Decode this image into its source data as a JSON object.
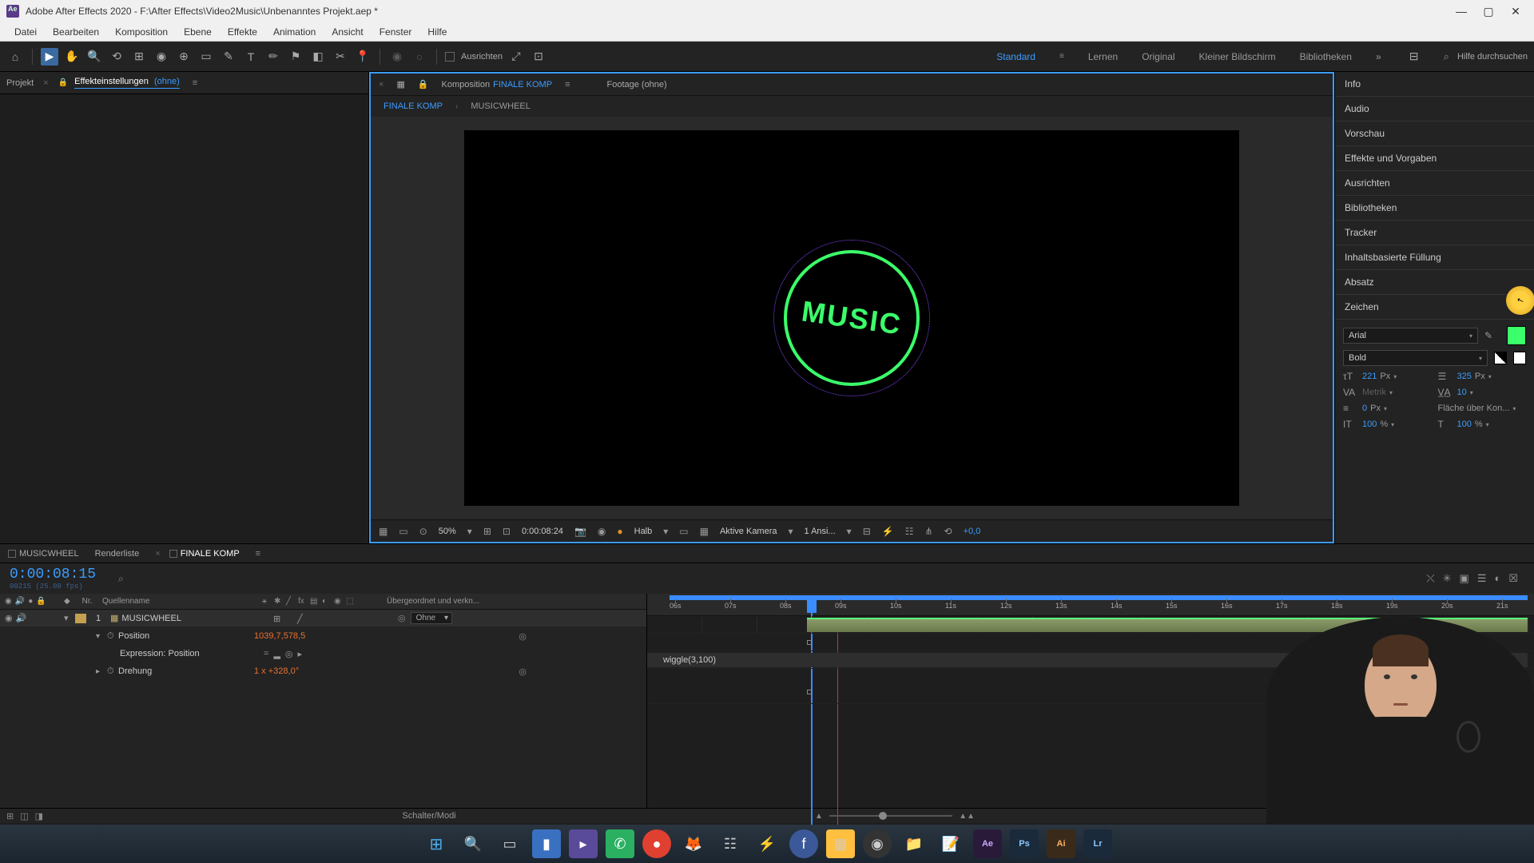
{
  "titlebar": {
    "text": "Adobe After Effects 2020 - F:\\After Effects\\Video2Music\\Unbenanntes Projekt.aep *"
  },
  "menubar": {
    "items": [
      "Datei",
      "Bearbeiten",
      "Komposition",
      "Ebene",
      "Effekte",
      "Animation",
      "Ansicht",
      "Fenster",
      "Hilfe"
    ]
  },
  "toolbar": {
    "align_label": "Ausrichten",
    "workspaces": {
      "items": [
        "Standard",
        "Lernen",
        "Original",
        "Kleiner Bildschirm",
        "Bibliotheken"
      ],
      "active": "Standard"
    },
    "search_placeholder": "Hilfe durchsuchen"
  },
  "left_panel": {
    "tabs": {
      "project": "Projekt",
      "effect_controls_prefix": "Effekteinstellungen",
      "effect_controls_suffix": "(ohne)"
    }
  },
  "center_panel": {
    "comp_tab_prefix": "Komposition",
    "comp_name": "FINALE KOMP",
    "footage_tab": "Footage  (ohne)",
    "breadcrumb": {
      "item1": "FINALE KOMP",
      "item2": "MUSICWHEEL"
    },
    "music_text": "MUSIC"
  },
  "viewport_controls": {
    "zoom": "50%",
    "timecode": "0:00:08:24",
    "resolution": "Halb",
    "camera": "Aktive Kamera",
    "views": "1 Ansi...",
    "exposure": "+0,0"
  },
  "right_panel": {
    "sections": [
      "Info",
      "Audio",
      "Vorschau",
      "Effekte und Vorgaben",
      "Ausrichten",
      "Bibliotheken",
      "Tracker",
      "Inhaltsbasierte Füllung",
      "Absatz"
    ],
    "character": {
      "title": "Zeichen",
      "font_family": "Arial",
      "font_style": "Bold",
      "font_size": "221",
      "font_size_unit": "Px",
      "leading": "325",
      "leading_unit": "Px",
      "kerning": "Metrik",
      "tracking": "10",
      "stroke_width": "0",
      "stroke_unit": "Px",
      "stroke_mode": "Fläche über Kon...",
      "vscale": "100",
      "hscale": "100",
      "percent": "%"
    }
  },
  "timeline": {
    "tabs": {
      "musicwheel": "MUSICWHEEL",
      "renderliste": "Renderliste",
      "finale_komp": "FINALE KOMP"
    },
    "timecode": "0:00:08:15",
    "framerate_hint": "00215 (25.00 fps)",
    "columns": {
      "nr": "Nr.",
      "name": "Quellenname",
      "parent": "Übergeordnet und verkn..."
    },
    "layer1": {
      "num": "1",
      "name": "MUSICWHEEL",
      "parent_none": "Ohne"
    },
    "props": {
      "position": "Position",
      "position_val": "1039,7,578,5",
      "expression_label": "Expression: Position",
      "rotation": "Drehung",
      "rotation_prefix": "1 x",
      "rotation_val": "+328,0°"
    },
    "expression_code": "wiggle(3,100)",
    "ruler_ticks": [
      "06s",
      "07s",
      "08s",
      "09s",
      "10s",
      "11s",
      "12s",
      "13s",
      "14s",
      "15s",
      "16s",
      "17s",
      "18s",
      "19s",
      "20s",
      "21s"
    ],
    "footer_label": "Schalter/Modi"
  }
}
